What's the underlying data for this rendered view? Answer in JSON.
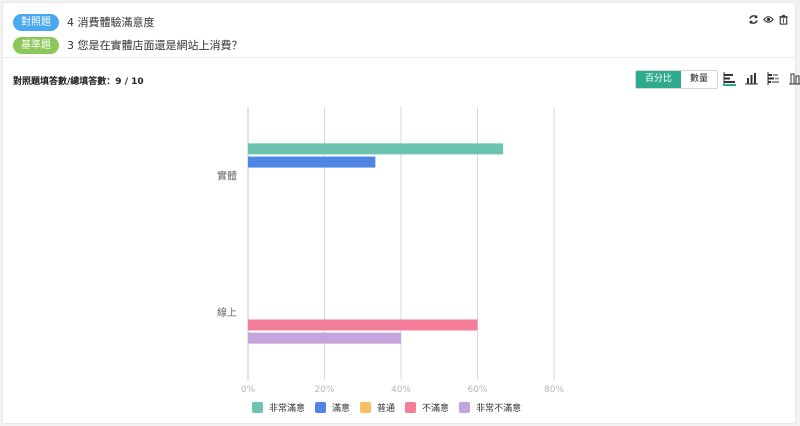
{
  "header": {
    "control_badge": "對照題",
    "control_question": "4 消費體驗滿意度",
    "base_badge": "基準題",
    "base_question": "3 您是在實體店面還是網站上消費？"
  },
  "summary": {
    "label": "對照題填答數/總填答數：",
    "value": "9 / 10"
  },
  "toggle": {
    "percent_label": "百分比",
    "count_label": "數量"
  },
  "icons": [
    "refresh-icon",
    "eye-icon",
    "trash-icon",
    "horizontal-bar-icon",
    "vertical-bar-icon",
    "stacked-bar-icon",
    "grouped-bar-icon"
  ],
  "colors": {
    "badge_blue": "#4aa8ee",
    "badge_green": "#8cc75a",
    "accent": "#2eaa8d"
  },
  "chart_data": {
    "type": "bar",
    "orientation": "horizontal",
    "categories": [
      "實體",
      "線上"
    ],
    "series": [
      {
        "name": "非常滿意",
        "color": "#6cc3b0",
        "values": [
          66.7,
          0
        ]
      },
      {
        "name": "滿意",
        "color": "#4f86e6",
        "values": [
          33.3,
          0
        ]
      },
      {
        "name": "普通",
        "color": "#f7c063",
        "values": [
          0,
          0
        ]
      },
      {
        "name": "不滿意",
        "color": "#f47e99",
        "values": [
          0,
          60
        ]
      },
      {
        "name": "非常不滿意",
        "color": "#c4a4dc",
        "values": [
          0,
          40
        ]
      }
    ],
    "xlim": [
      0,
      80
    ],
    "x_ticks": [
      "0%",
      "20%",
      "40%",
      "60%",
      "80%"
    ],
    "grid": true,
    "legend_position": "bottom"
  }
}
